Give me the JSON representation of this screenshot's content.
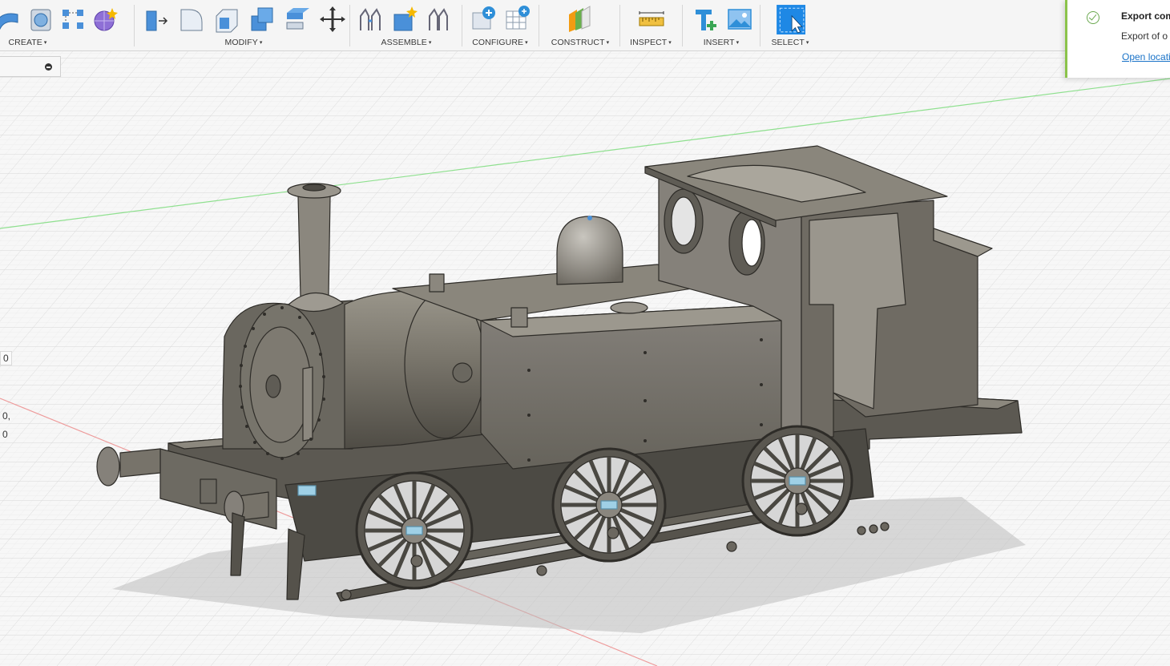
{
  "toolbar": {
    "groups": {
      "create": {
        "label": "CREATE"
      },
      "modify": {
        "label": "MODIFY"
      },
      "assemble": {
        "label": "ASSEMBLE"
      },
      "configure": {
        "label": "CONFIGURE"
      },
      "construct": {
        "label": "CONSTRUCT"
      },
      "inspect": {
        "label": "INSPECT"
      },
      "insert": {
        "label": "INSERT"
      },
      "select": {
        "label": "SELECT"
      }
    },
    "caret": "▾"
  },
  "readouts": [
    "0",
    "0,",
    "0"
  ],
  "notification": {
    "title": "Export com",
    "message": "Export of o",
    "link": "Open locati"
  },
  "colors": {
    "accent": "#1e88e5",
    "success": "#8bc34a",
    "model": "#6e6a60",
    "grid": "#d2d2d2"
  }
}
